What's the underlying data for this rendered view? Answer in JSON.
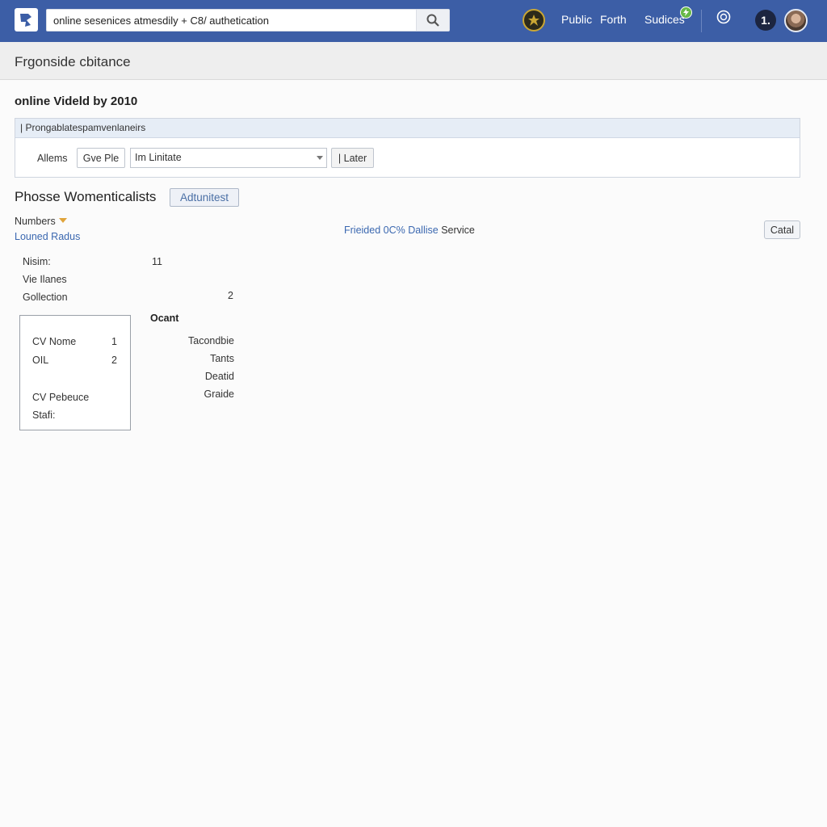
{
  "topbar": {
    "search_value": "online sesenices atmesdily + C8/ authetication",
    "nav": [
      "Public",
      "Forth",
      "Sudices"
    ],
    "notification_badge": "",
    "count_badge": "1.",
    "brand_color": "#3c5ea6"
  },
  "page": {
    "title": "Frgonside cbitance",
    "section_heading": "online Videld by 2010"
  },
  "filter": {
    "header": "| Prongablatespamvenlaneirs",
    "label": "Allems",
    "button_gve": "Gve Ple",
    "select_value": "Im Linitate",
    "button_later": "| Later"
  },
  "content": {
    "subtitle": "Phosse Womenticalists",
    "admin_button": "Adtunitest",
    "numbers_label": "Numbers",
    "radius_link": "Louned Radus",
    "center_link": "Frieided 0C% Dallise",
    "center_plain": "Service",
    "catal_button": "Catal"
  },
  "details": [
    {
      "label": "Nisim:",
      "value": "11"
    },
    {
      "label": "Vie Ilanes",
      "value": ""
    },
    {
      "label": "Gollection",
      "value": "2"
    }
  ],
  "card": {
    "rows": [
      {
        "label": "CV Nome",
        "value": "1"
      },
      {
        "label": "OIL",
        "value": "2"
      },
      {
        "label": "CV Pebeuce",
        "value": ""
      },
      {
        "label": "Stafi:",
        "value": ""
      }
    ]
  },
  "right_column": {
    "title": "Ocant",
    "items": [
      "Tacondbie",
      "Tants",
      "Deatid",
      "Graide"
    ]
  }
}
